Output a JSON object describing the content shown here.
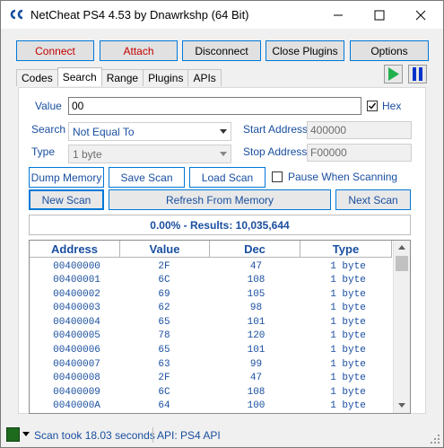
{
  "window": {
    "title": "NetCheat PS4 4.53 by Dnawrkshp (64 Bit)"
  },
  "toolbar": {
    "connect": "Connect",
    "attach": "Attach",
    "disconnect": "Disconnect",
    "close_plugins": "Close Plugins",
    "options": "Options"
  },
  "tabs": [
    {
      "label": "Codes"
    },
    {
      "label": "Search"
    },
    {
      "label": "Range"
    },
    {
      "label": "Plugins"
    },
    {
      "label": "APIs"
    }
  ],
  "search": {
    "value_label": "Value",
    "value": "00",
    "hex_label": "Hex",
    "hex_checked": true,
    "search_label": "Search",
    "search_mode": "Not Equal To",
    "type_label": "Type",
    "type_value": "1 byte",
    "start_label": "Start Address",
    "start_value": "400000",
    "stop_label": "Stop Address",
    "stop_value": "F00000",
    "dump_memory": "Dump Memory",
    "save_scan": "Save Scan",
    "load_scan": "Load Scan",
    "pause_label": "Pause When Scanning",
    "new_scan": "New Scan",
    "refresh": "Refresh From Memory",
    "next_scan": "Next Scan",
    "progress_text": "0.00% - Results: 10,035,644"
  },
  "results": {
    "columns": [
      "Address",
      "Value",
      "Dec",
      "Type"
    ],
    "rows": [
      [
        "00400000",
        "2F",
        "47",
        "1 byte"
      ],
      [
        "00400001",
        "6C",
        "108",
        "1 byte"
      ],
      [
        "00400002",
        "69",
        "105",
        "1 byte"
      ],
      [
        "00400003",
        "62",
        "98",
        "1 byte"
      ],
      [
        "00400004",
        "65",
        "101",
        "1 byte"
      ],
      [
        "00400005",
        "78",
        "120",
        "1 byte"
      ],
      [
        "00400006",
        "65",
        "101",
        "1 byte"
      ],
      [
        "00400007",
        "63",
        "99",
        "1 byte"
      ],
      [
        "00400008",
        "2F",
        "47",
        "1 byte"
      ],
      [
        "00400009",
        "6C",
        "108",
        "1 byte"
      ],
      [
        "0040000A",
        "64",
        "100",
        "1 byte"
      ]
    ]
  },
  "status": {
    "scan_time": "Scan took 18.03 seconds",
    "api": "API: PS4 API"
  },
  "colors": {
    "accent": "#0078d7",
    "label_blue": "#1a4fa0",
    "connect_red": "#c00000",
    "play_green": "#22b14c",
    "pause_blue": "#0033cc",
    "status_green": "#1e6b1e"
  }
}
